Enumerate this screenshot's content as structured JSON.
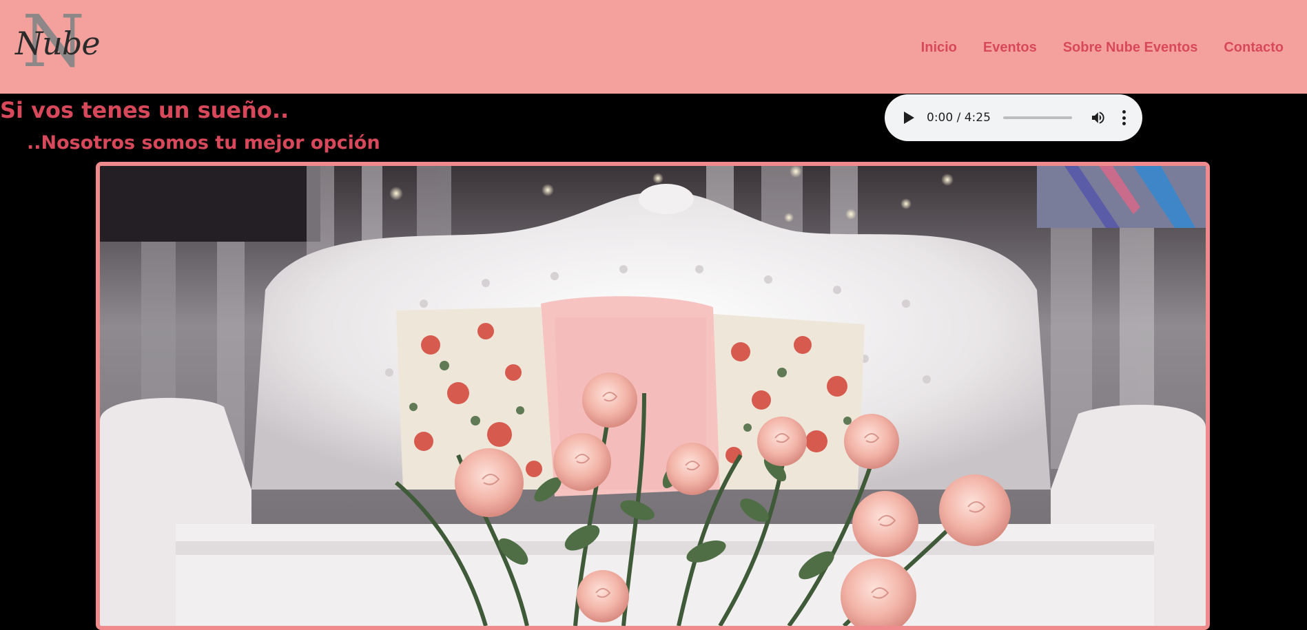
{
  "header": {
    "logo": {
      "letter": "N",
      "script": "Nube"
    },
    "nav": [
      {
        "label": "Inicio"
      },
      {
        "label": "Eventos"
      },
      {
        "label": "Sobre Nube Eventos"
      },
      {
        "label": "Contacto"
      }
    ]
  },
  "main": {
    "headline": "Si vos tenes un sueño..",
    "subheadline": "..Nosotros somos tu mejor opción",
    "audio": {
      "time": "0:00 / 4:25",
      "progress": 0.0,
      "play_icon": "play-icon",
      "volume_icon": "volume-icon",
      "menu_icon": "more-vert-icon"
    },
    "hero_image": {
      "subject": "white tufted sofa with floral cushions and pink roses"
    }
  },
  "colors": {
    "header_bg": "#f4a19e",
    "accent": "#d8485b",
    "page_bg": "#000000",
    "frame_border": "#ef8a8d"
  }
}
